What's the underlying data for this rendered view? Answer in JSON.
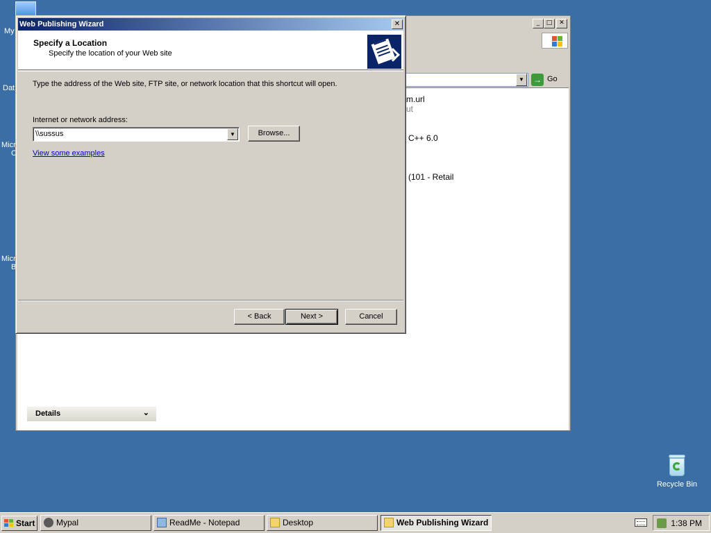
{
  "desktop": {
    "left_labels": [
      "My",
      "Dat",
      "Micr",
      "C",
      "Micr",
      "B"
    ],
    "recycle_bin": "Recycle Bin"
  },
  "explorer": {
    "go_label": "Go",
    "list_items": [
      "m.url",
      "ut",
      "C++ 6.0",
      "(101 - Retail"
    ],
    "details_label": "Details"
  },
  "wizard": {
    "title": "Web Publishing Wizard",
    "close_glyph": "✕",
    "header_title": "Specify a Location",
    "header_subtitle": "Specify the location of your Web site",
    "instruction": "Type the address of the Web site, FTP site, or network location that this shortcut will open.",
    "address_label": "Internet or network address:",
    "address_value": "\\\\sussus",
    "browse_label": "Browse...",
    "examples_link": "View some examples",
    "examples_suffix": ".",
    "back_label": "< Back",
    "next_label": "Next >",
    "cancel_label": "Cancel"
  },
  "taskbar": {
    "start_label": "Start",
    "tasks": [
      "Mypal",
      "ReadMe - Notepad",
      "Desktop",
      "Web Publishing Wizard"
    ],
    "clock": "1:38 PM"
  }
}
